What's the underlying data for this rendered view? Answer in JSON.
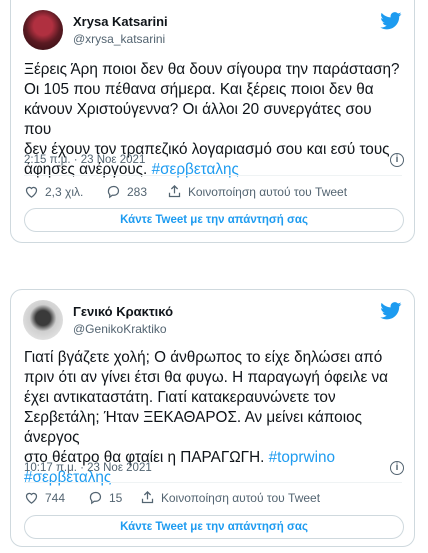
{
  "tweets": [
    {
      "author": "Xrysa Katsarini",
      "handle": "@xrysa_katsarini",
      "text": "Ξέρεις Άρη ποιοι δεν θα δουν σίγουρα την παράσταση?\nΟι 105 που πέθανα σήμερα. Και ξέρεις ποιοι δεν θα\nκάνουν Χριστούγεννα? Οι άλλοι 20 συνεργάτες σου που\nδεν έχουν τον τραπεζικό λογαριασμό σου και εσύ τους\nάφησες ανέργους.",
      "hashtags": [
        "#σερβεταλης"
      ],
      "timestamp": "2:15 π.μ. · 23 Νοε 2021",
      "likes": "2,3 χιλ.",
      "replies": "283",
      "share_label": "Κοινοποίηση αυτού του Tweet",
      "reply_button": "Κάντε Tweet με την απάντησή σας"
    },
    {
      "author": "Γενικό Κρακτικό",
      "handle": "@GenikoKraktiko",
      "text": "Γιατί βγάζετε χολή; Ο άνθρωπος το είχε δηλώσει από\nπριν ότι αν γίνει έτσι θα φυγω. Η παραγωγή όφειλε να\nέχει αντικαταστάτη. Γιατί κατακεραυνώνετε τον\nΣερβετάλη; Ήταν ΞΕΚΑΘΑΡΟΣ. Αν μείνει κάποιος άνεργος\nστο θέατρο θα φταίει η ΠΑΡΑΓΩΓΗ.",
      "hashtags": [
        "#toprwino",
        "#σερβεταλης"
      ],
      "timestamp": "10:17 π.μ. · 23 Νοε 2021",
      "likes": "744",
      "replies": "15",
      "share_label": "Κοινοποίηση αυτού του Tweet",
      "reply_button": "Κάντε Tweet με την απάντησή σας"
    }
  ],
  "colors": {
    "accent": "#1d9bf0",
    "muted": "#536471",
    "border": "#cfd9de"
  },
  "icons": [
    "twitter-bird-icon",
    "info-icon",
    "heart-icon",
    "reply-icon",
    "share-icon"
  ]
}
